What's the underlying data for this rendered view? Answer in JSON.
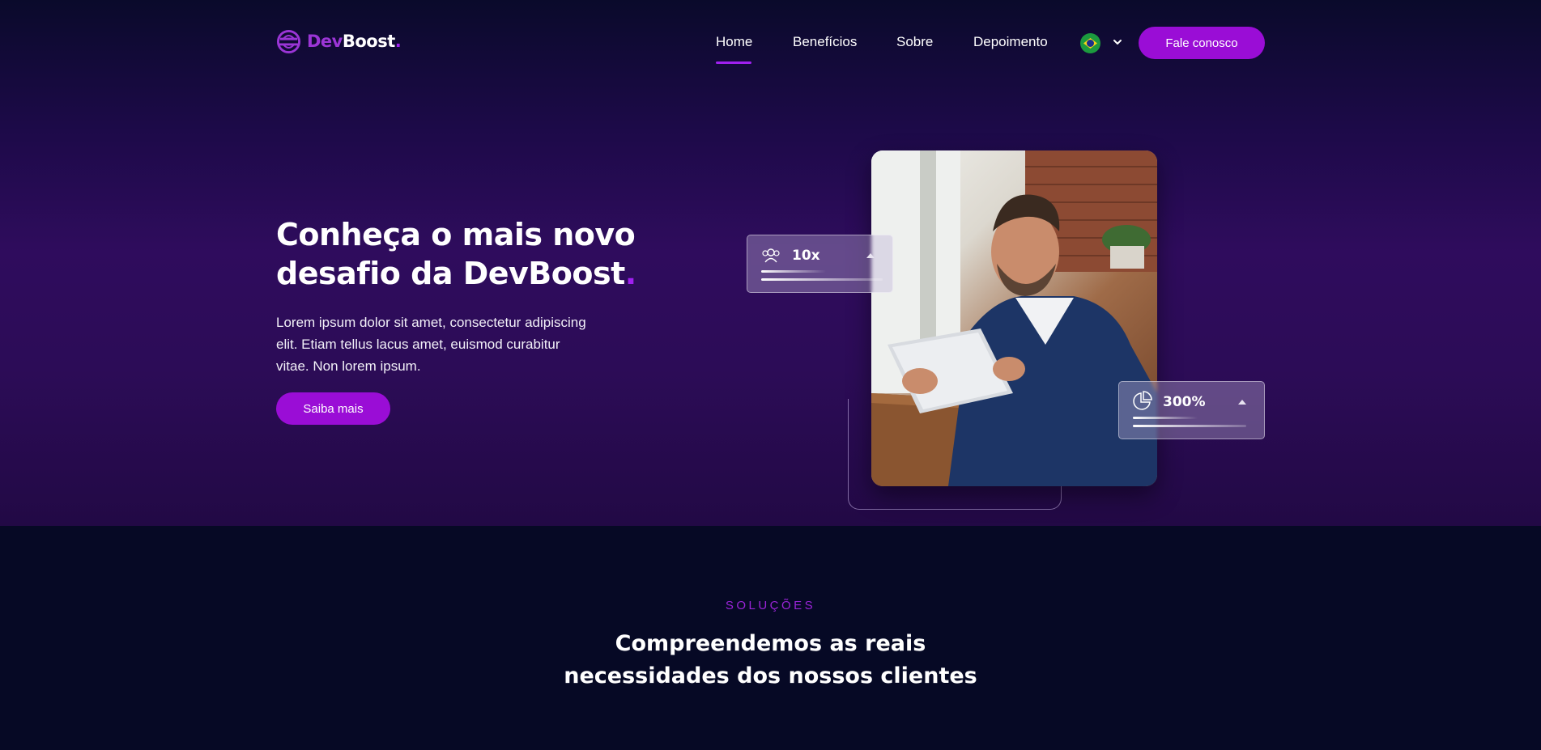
{
  "brand": {
    "dev": "Dev",
    "boost": "Boost",
    "dot": "."
  },
  "nav": {
    "items": [
      {
        "label": "Home",
        "active": true
      },
      {
        "label": "Benefícios"
      },
      {
        "label": "Sobre"
      },
      {
        "label": "Depoimento"
      }
    ],
    "language_flag": "brazil-flag-icon",
    "contact_label": "Fale conosco"
  },
  "hero": {
    "title_line1": "Conheça o mais novo",
    "title_line2": "desafio da DevBoost",
    "title_dot": ".",
    "lead": "Lorem ipsum dolor sit amet, consectetur adipiscing elit. Etiam tellus lacus amet, euismod curabitur vitae. Non lorem ipsum.",
    "cta_label": "Saiba mais",
    "stats": [
      {
        "icon": "users-icon",
        "value": "10x"
      },
      {
        "icon": "pie-chart-icon",
        "value": "300%"
      }
    ]
  },
  "solutions": {
    "eyebrow": "SOLUÇÕES",
    "title_line1": "Compreendemos as reais",
    "title_line2": "necessidades dos nossos clientes"
  },
  "colors": {
    "accent": "#9a0dd6",
    "background_dark": "#060925",
    "hero_purple": "#2f0c5d"
  }
}
